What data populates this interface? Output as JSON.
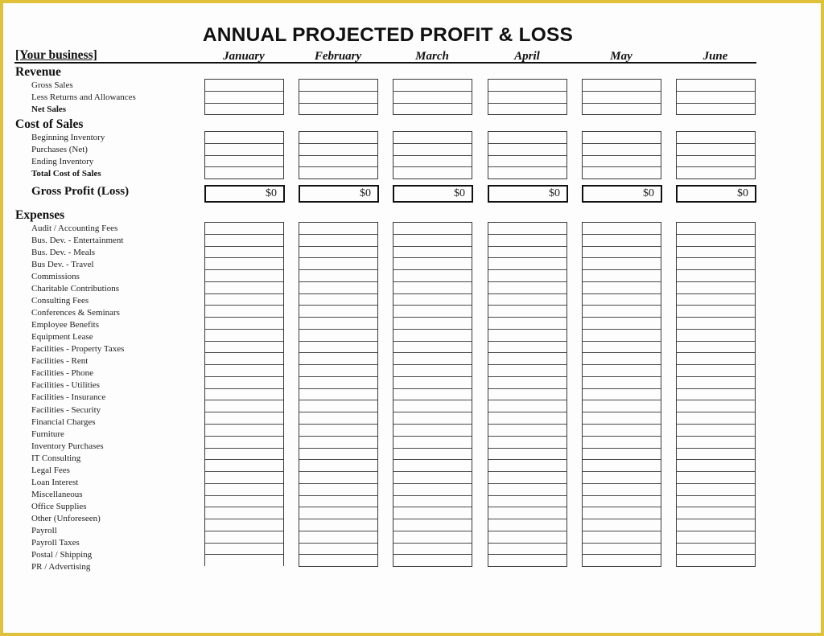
{
  "document": {
    "title": "ANNUAL PROJECTED PROFIT & LOSS",
    "business_placeholder": "[Your business]",
    "months": [
      "January",
      "February",
      "March",
      "April",
      "May",
      "June"
    ]
  },
  "revenue": {
    "heading": "Revenue",
    "items": [
      {
        "label": "Gross Sales",
        "bold": false
      },
      {
        "label": "Less Returns and Allowances",
        "bold": false
      },
      {
        "label": "Net Sales",
        "bold": true
      }
    ]
  },
  "cost_of_sales": {
    "heading": "Cost of Sales",
    "items": [
      {
        "label": "Beginning Inventory",
        "bold": false
      },
      {
        "label": "Purchases (Net)",
        "bold": false
      },
      {
        "label": "Ending Inventory",
        "bold": false
      },
      {
        "label": "Total Cost of Sales",
        "bold": true
      }
    ]
  },
  "gross_profit": {
    "label": "Gross Profit (Loss)",
    "values": [
      "$0",
      "$0",
      "$0",
      "$0",
      "$0",
      "$0"
    ]
  },
  "expenses": {
    "heading": "Expenses",
    "items": [
      "Audit / Accounting Fees",
      "Bus. Dev. - Entertainment",
      "Bus. Dev. - Meals",
      "Bus Dev. - Travel",
      "Commissions",
      "Charitable Contributions",
      "Consulting Fees",
      "Conferences & Seminars",
      "Employee Benefits",
      "Equipment Lease",
      "Facilities - Property Taxes",
      "Facilities - Rent",
      "Facilities - Phone",
      "Facilities - Utilities",
      "Facilities - Insurance",
      "Facilities - Security",
      "Financial Charges",
      "Furniture",
      "Inventory Purchases",
      "IT Consulting",
      "Legal Fees",
      "Loan Interest",
      "Miscellaneous",
      "Office Supplies",
      "Other (Unforeseen)",
      "Payroll",
      "Payroll Taxes",
      "Postal / Shipping",
      "PR / Advertising"
    ]
  },
  "colors": {
    "frame": "#e0c13a",
    "page": "#fdfdfd",
    "ink": "#111111"
  }
}
